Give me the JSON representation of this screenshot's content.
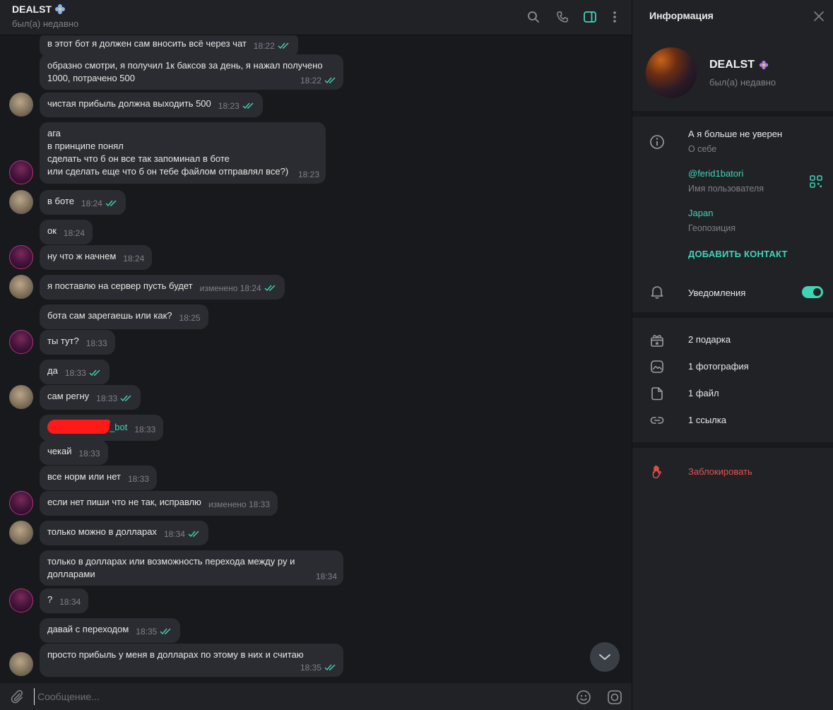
{
  "chat_header": {
    "title": "DEALST",
    "status": "был(а) недавно",
    "icons": [
      "search-icon",
      "phone-icon",
      "sidebar-toggle-icon",
      "more-icon"
    ]
  },
  "messages": [
    {
      "side": "me",
      "text": "в этот бот я должен сам вносить всё через чат",
      "time": "18:22",
      "read": true
    },
    {
      "side": "me",
      "lines": [
        "образно смотри, я получил 1к баксов за день, я нажал получено",
        "1000, потрачено 500"
      ],
      "time": "18:22",
      "read": true
    },
    {
      "side": "me",
      "text": "чистая прибыль должна выходить 500",
      "time": "18:23",
      "read": true
    },
    {
      "side": "them",
      "lines": [
        "ага",
        "в принципе понял",
        "сделать что б он все так запоминал в боте",
        "или сделать еще что б он тебе файлом отправлял все?)"
      ],
      "time": "18:23"
    },
    {
      "side": "me",
      "text": "в боте",
      "time": "18:24",
      "read": true
    },
    {
      "side": "them",
      "text": "ок",
      "time": "18:24"
    },
    {
      "side": "them",
      "text": "ну что ж начнем",
      "time": "18:24"
    },
    {
      "side": "me",
      "text": "я поставлю на сервер пусть будет",
      "time": "изменено 18:24",
      "read": true
    },
    {
      "side": "them",
      "text": "бота сам зарегаешь или как?",
      "time": "18:25"
    },
    {
      "side": "them",
      "text": "ты тут?",
      "time": "18:33"
    },
    {
      "side": "me",
      "text": "да",
      "time": "18:33",
      "read": true
    },
    {
      "side": "me",
      "text": "сам регну",
      "time": "18:33",
      "read": true
    },
    {
      "side": "them",
      "text": "_bot",
      "time": "18:33"
    },
    {
      "side": "them",
      "text": "чекай",
      "time": "18:33"
    },
    {
      "side": "them",
      "text": "все норм или нет",
      "time": "18:33"
    },
    {
      "side": "them",
      "text": "если нет пиши что не так, исправлю",
      "time": "изменено 18:33"
    },
    {
      "side": "me",
      "text": "только можно в долларах",
      "time": "18:34",
      "read": true
    },
    {
      "side": "them",
      "lines": [
        "только в долларах или возможность перехода между ру и",
        "долларами"
      ],
      "time": "18:34"
    },
    {
      "side": "them",
      "text": "?",
      "time": "18:34"
    },
    {
      "side": "me",
      "text": "давай с переходом",
      "time": "18:35",
      "read": true
    },
    {
      "side": "me",
      "text": "просто прибыль у меня в долларах по этому в них и считаю",
      "time": "18:35",
      "read": true
    }
  ],
  "composer": {
    "placeholder": "Сообщение..."
  },
  "info": {
    "title": "Информация",
    "name": "DEALST",
    "status": "был(а) недавно",
    "bio": "А я больше не уверен",
    "bio_label": "О себе",
    "username": "@ferid1batori",
    "username_label": "Имя пользователя",
    "location": "Japan",
    "location_label": "Геопозиция",
    "add_contact": "ДОБАВИТЬ КОНТАКТ",
    "notifications": "Уведомления",
    "notifications_on": true,
    "gifts": "2 подарка",
    "photos": "1 фотография",
    "files": "1 файл",
    "links": "1 ссылка",
    "block": "Заблокировать"
  },
  "colors": {
    "accent": "#40d4b6",
    "danger": "#e5534b",
    "bubble": "#2b2c31",
    "background": "#18191d",
    "panel": "#212226"
  }
}
